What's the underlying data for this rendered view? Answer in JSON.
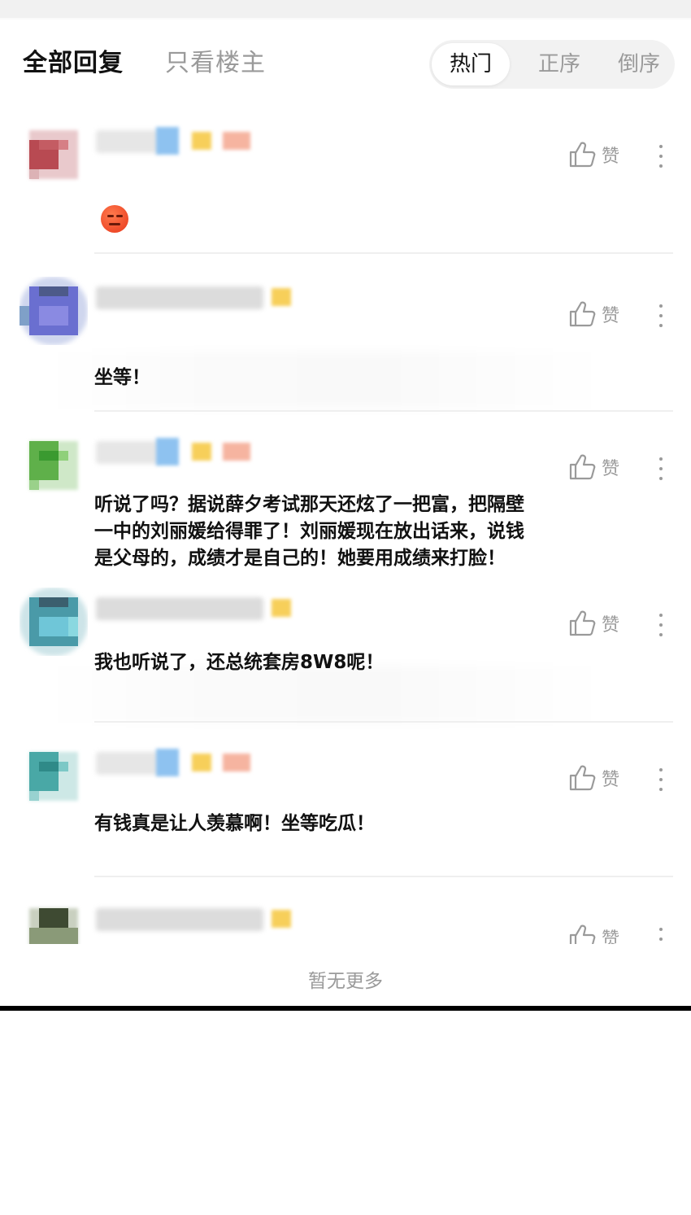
{
  "tabs": {
    "all_replies": "全部回复",
    "op_only": "只看楼主"
  },
  "sort": {
    "hot": "热门",
    "ascending": "正序",
    "descending": "倒序",
    "selected": "热门"
  },
  "like_label": "赞",
  "comments": [
    {
      "text": "",
      "has_emoji": true,
      "avatar_color": "#b84a52"
    },
    {
      "text": "坐等！",
      "avatar_color": "#6a6fd0"
    },
    {
      "text_lines": [
        "听说了吗？据说薛夕考试那天还炫了一把富，把隔壁",
        "一中的刘丽媛给得罪了！刘丽媛现在放出话来，说钱",
        "是父母的，成绩才是自己的！她要用成绩来打脸！"
      ],
      "avatar_color": "#5fb04a"
    },
    {
      "text": "我也听说了，还总统套房8W8呢！",
      "avatar_color": "#4a9aa8"
    },
    {
      "text": "有钱真是让人羡慕啊！坐等吃瓜！",
      "avatar_color": "#49a8a6"
    },
    {
      "text": "",
      "avatar_color": "#6b7a5a"
    }
  ],
  "footer": {
    "no_more": "暂无更多"
  },
  "colors": {
    "primary_text": "#111111",
    "secondary_text": "#9a9a9a",
    "sort_bg": "#f2f2f2",
    "divider": "#efefef"
  },
  "icons": {
    "like": "thumbs-up-icon",
    "more": "more-vertical-icon"
  }
}
